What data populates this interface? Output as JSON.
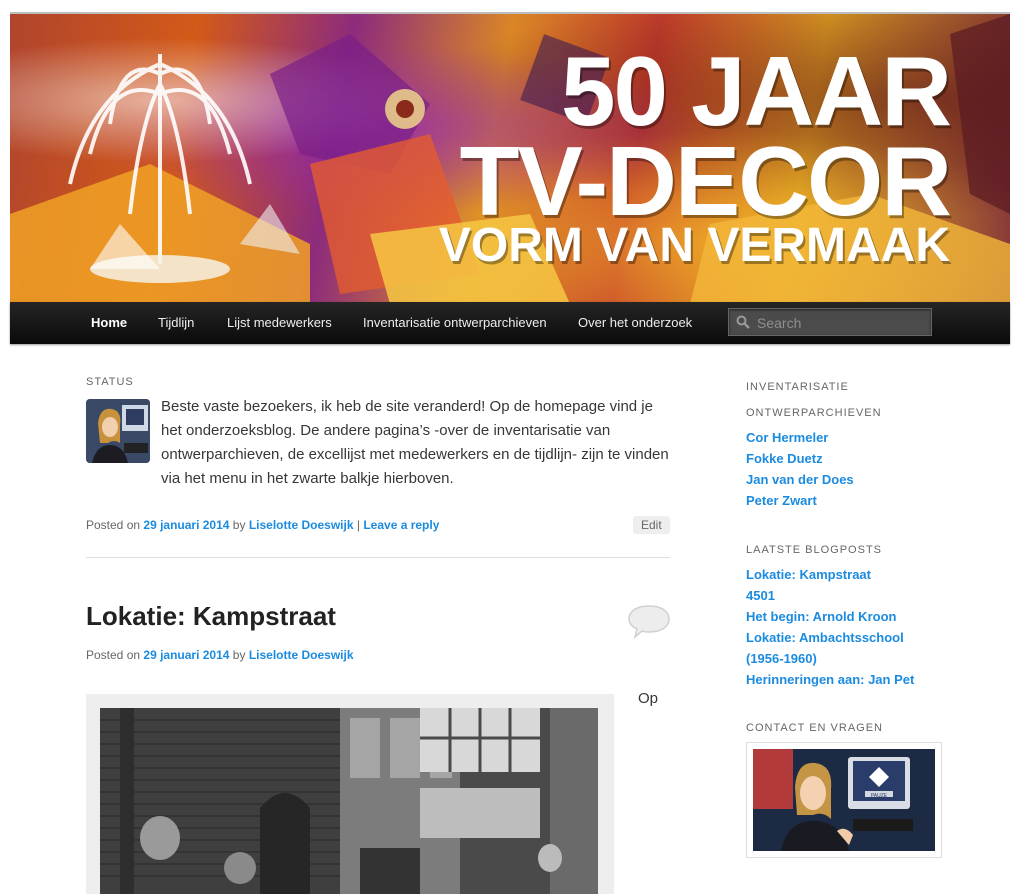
{
  "banner": {
    "line1": "50 JAAR",
    "line2": "TV-DECOR",
    "line3": "VORM VAN VERMAAK"
  },
  "nav": {
    "items": [
      {
        "label": "Home",
        "active": true
      },
      {
        "label": "Tijdlijn"
      },
      {
        "label": "Lijst medewerkers"
      },
      {
        "label": "Inventarisatie ontwerparchieven"
      },
      {
        "label": "Over het onderzoek"
      }
    ],
    "search_placeholder": "Search"
  },
  "status_post": {
    "label": "STATUS",
    "text": "Beste vaste bezoekers, ik heb de site veranderd! Op de homepage vind je het onderzoeksblog. De andere pagina’s -over de inventarisatie van ontwerparchieven, de excellijst met medewerkers en de tijdlijn- zijn te vinden via het menu in het zwarte balkje hierboven.",
    "meta_posted_on": "Posted on",
    "date": "29 januari 2014",
    "meta_by": "by",
    "author": "Liselotte Doeswijk",
    "separator": "|",
    "reply": "Leave a reply",
    "edit": "Edit"
  },
  "article": {
    "title": "Lokatie: Kampstraat",
    "meta_posted_on": "Posted on",
    "date": "29 januari 2014",
    "meta_by": "by",
    "author": "Liselotte Doeswijk",
    "excerpt_start": "Op"
  },
  "sidebar": {
    "inventory": {
      "title_line1": "INVENTARISATIE",
      "title_line2": "ONTWERPARCHIEVEN",
      "items": [
        "Cor Hermeler",
        "Fokke Duetz",
        "Jan van der Does",
        "Peter Zwart"
      ]
    },
    "recent": {
      "title": "LAATSTE BLOGPOSTS",
      "items": [
        "Lokatie: Kampstraat",
        "4501",
        "Het begin: Arnold Kroon",
        "Lokatie: Ambachtsschool (1956-1960)",
        "Herinneringen aan: Jan Pet"
      ]
    },
    "contact": {
      "title": "CONTACT EN VRAGEN",
      "screen_text": "PAUZE"
    }
  },
  "colors": {
    "link": "#1b8be0",
    "nav_bg": "#111111",
    "text": "#373737"
  }
}
